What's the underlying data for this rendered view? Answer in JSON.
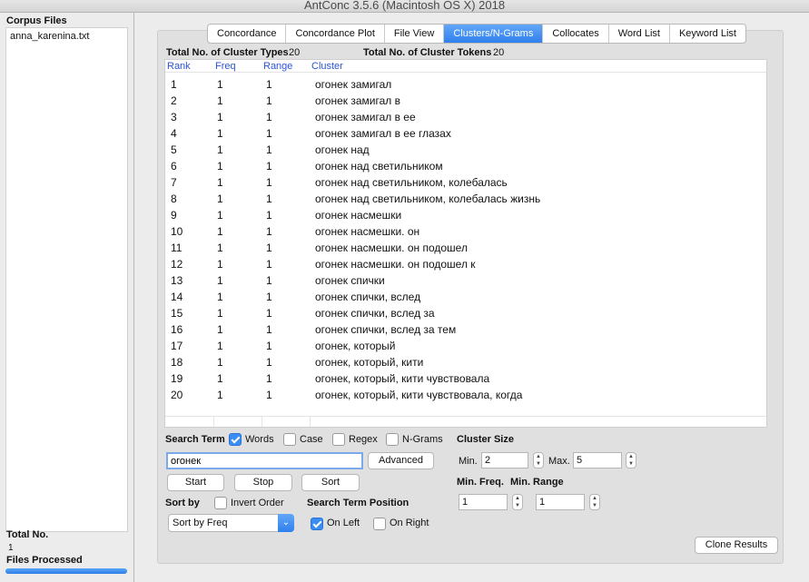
{
  "window": {
    "title": "AntConc 3.5.6 (Macintosh OS X) 2018"
  },
  "sidebar": {
    "title": "Corpus Files",
    "files": [
      "anna_karenina.txt"
    ],
    "total_label": "Total No.",
    "total_value": "1",
    "processed_label": "Files Processed",
    "progress": 1.0
  },
  "tabs": [
    {
      "label": "Concordance",
      "active": false
    },
    {
      "label": "Concordance Plot",
      "active": false
    },
    {
      "label": "File View",
      "active": false
    },
    {
      "label": "Clusters/N-Grams",
      "active": true
    },
    {
      "label": "Collocates",
      "active": false
    },
    {
      "label": "Word List",
      "active": false
    },
    {
      "label": "Keyword List",
      "active": false
    }
  ],
  "stats": {
    "types_label": "Total No. of Cluster Types",
    "types_value": "20",
    "tokens_label": "Total No. of Cluster Tokens",
    "tokens_value": "20"
  },
  "table": {
    "headers": [
      "Rank",
      "Freq",
      "Range",
      "Cluster"
    ],
    "rows": [
      [
        "1",
        "1",
        "1",
        "огонек замигал"
      ],
      [
        "2",
        "1",
        "1",
        "огонек замигал в"
      ],
      [
        "3",
        "1",
        "1",
        "огонек замигал в ее"
      ],
      [
        "4",
        "1",
        "1",
        "огонек замигал в ее глазах"
      ],
      [
        "5",
        "1",
        "1",
        "огонек над"
      ],
      [
        "6",
        "1",
        "1",
        "огонек над светильником"
      ],
      [
        "7",
        "1",
        "1",
        "огонек над светильником, колебалась"
      ],
      [
        "8",
        "1",
        "1",
        "огонек над светильником, колебалась жизнь"
      ],
      [
        "9",
        "1",
        "1",
        "огонек насмешки"
      ],
      [
        "10",
        "1",
        "1",
        "огонек насмешки. он"
      ],
      [
        "11",
        "1",
        "1",
        "огонек насмешки. он подошел"
      ],
      [
        "12",
        "1",
        "1",
        "огонек насмешки. он подошел к"
      ],
      [
        "13",
        "1",
        "1",
        "огонек спички"
      ],
      [
        "14",
        "1",
        "1",
        "огонек спички, вслед"
      ],
      [
        "15",
        "1",
        "1",
        "огонек спички, вслед за"
      ],
      [
        "16",
        "1",
        "1",
        "огонек спички, вслед за тем"
      ],
      [
        "17",
        "1",
        "1",
        "огонек, который"
      ],
      [
        "18",
        "1",
        "1",
        "огонек, который, кити"
      ],
      [
        "19",
        "1",
        "1",
        "огонек, который, кити чувствовала"
      ],
      [
        "20",
        "1",
        "1",
        "огонек, который, кити чувствовала, когда"
      ]
    ]
  },
  "controls": {
    "search_term_label": "Search Term",
    "words_label": "Words",
    "words_checked": true,
    "case_label": "Case",
    "case_checked": false,
    "regex_label": "Regex",
    "regex_checked": false,
    "ngrams_label": "N-Grams",
    "ngrams_checked": false,
    "search_value": "огонек",
    "advanced_label": "Advanced",
    "start_label": "Start",
    "stop_label": "Stop",
    "sort_label": "Sort",
    "sort_by_label": "Sort by",
    "invert_label": "Invert Order",
    "invert_checked": false,
    "sort_value": "Sort by Freq",
    "position_label": "Search Term Position",
    "on_left_label": "On Left",
    "on_left_checked": true,
    "on_right_label": "On Right",
    "on_right_checked": false,
    "cluster_size_label": "Cluster Size",
    "min_label": "Min.",
    "min_value": "2",
    "max_label": "Max.",
    "max_value": "5",
    "min_freq_label": "Min. Freq.",
    "min_freq_value": "1",
    "min_range_label": "Min. Range",
    "min_range_value": "1",
    "clone_label": "Clone Results"
  }
}
